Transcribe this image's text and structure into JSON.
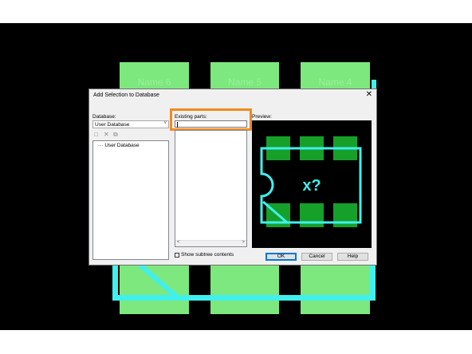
{
  "canvas": {
    "pad_labels": [
      "Name 6",
      "Name 5",
      "Name 4"
    ],
    "colors": {
      "background": "#000000",
      "pad": "#7de87d",
      "outline": "#3ff0ee",
      "highlight": "#f08a1e"
    }
  },
  "dialog": {
    "title": "Add Selection to Database",
    "close_glyph": "✕",
    "database": {
      "label": "Database:",
      "selected": "User Database",
      "toolbar_icons": [
        "new-folder-icon",
        "delete-icon",
        "copy-icon"
      ],
      "tree_items": [
        "User Database"
      ]
    },
    "existing_parts": {
      "label": "Existing parts:",
      "value": ""
    },
    "preview": {
      "label": "Preview:",
      "placeholder_text": "x?"
    },
    "show_subtree": {
      "label": "Show subtree contents",
      "checked": false
    },
    "buttons": {
      "ok": "OK",
      "cancel": "Cancel",
      "help": "Help"
    }
  }
}
